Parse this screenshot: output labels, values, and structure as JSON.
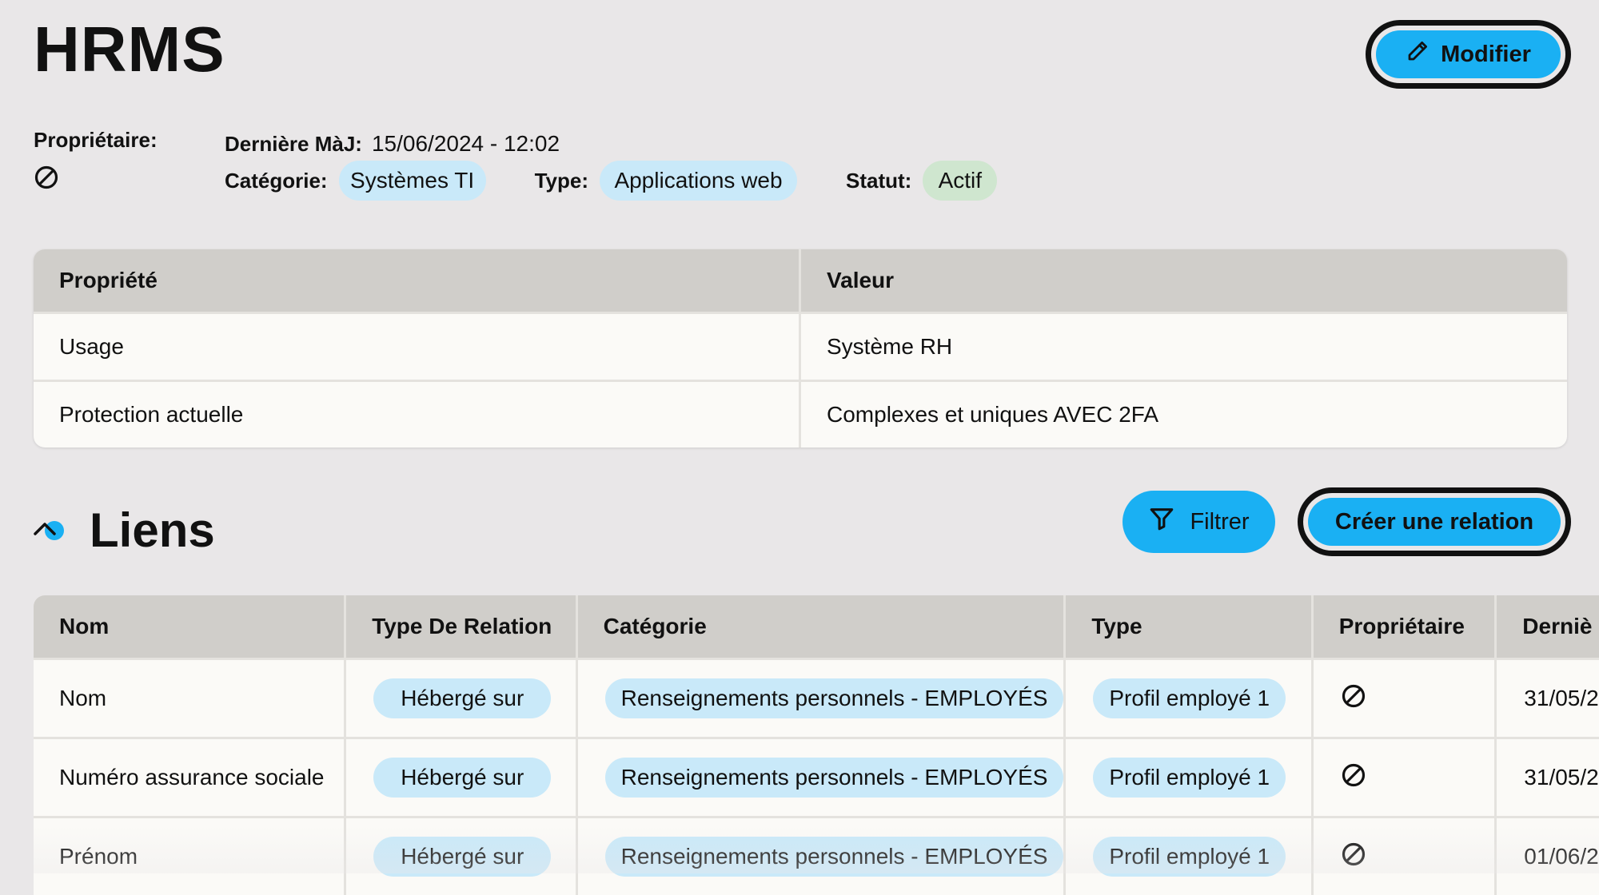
{
  "header": {
    "title": "HRMS",
    "edit_label": "Modifier",
    "edit_icon": "pencil-icon"
  },
  "meta": {
    "owner_label": "Propriétaire:",
    "owner_icon": "no-owner-icon",
    "updated_label": "Dernière MàJ:",
    "updated_value": "15/06/2024 - 12:02",
    "category_label": "Catégorie:",
    "category_value": "Systèmes TI",
    "type_label": "Type:",
    "type_value": "Applications web",
    "status_label": "Statut:",
    "status_value": "Actif"
  },
  "properties": {
    "headers": [
      "Propriété",
      "Valeur"
    ],
    "rows": [
      {
        "property": "Usage",
        "value": "Système RH"
      },
      {
        "property": "Protection actuelle",
        "value": "Complexes et uniques AVEC 2FA"
      }
    ]
  },
  "links": {
    "title": "Liens",
    "collapse_icon": "chevron-up-icon",
    "filter_label": "Filtrer",
    "filter_icon": "filter-icon",
    "create_label": "Créer une relation",
    "headers": [
      "Nom",
      "Type De Relation",
      "Catégorie",
      "Type",
      "Propriétaire",
      "Derniè"
    ],
    "rows": [
      {
        "name": "Nom",
        "relation": "Hébergé sur",
        "category": "Renseignements personnels - EMPLOYÉS",
        "type": "Profil employé 1",
        "owner_icon": "no-owner-icon",
        "updated": "31/05/2"
      },
      {
        "name": "Numéro assurance sociale",
        "relation": "Hébergé sur",
        "category": "Renseignements personnels - EMPLOYÉS",
        "type": "Profil employé 1",
        "owner_icon": "no-owner-icon",
        "updated": "31/05/2"
      },
      {
        "name": "Prénom",
        "relation": "Hébergé sur",
        "category": "Renseignements personnels - EMPLOYÉS",
        "type": "Profil employé 1",
        "owner_icon": "no-owner-icon",
        "updated": "01/06/2"
      }
    ]
  },
  "colors": {
    "accent": "#1ab0f3",
    "pill_blue": "#c9e9f9",
    "pill_green": "#cfe6cf",
    "page_bg": "#e9e7e8",
    "table_header_bg": "#d0ceca"
  }
}
